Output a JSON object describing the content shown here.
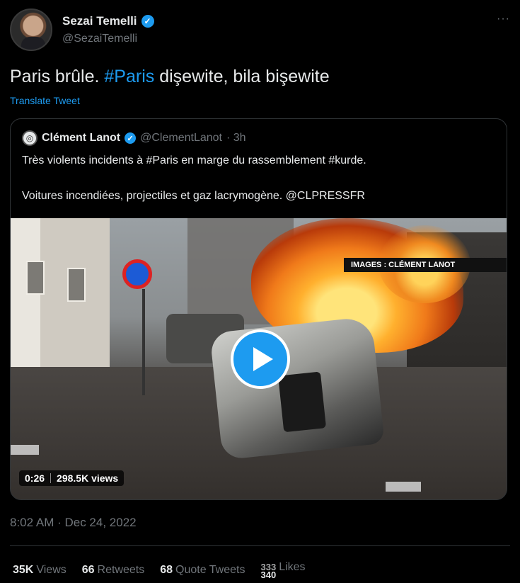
{
  "author": {
    "display_name": "Sezai Temelli",
    "handle": "@SezaiTemelli",
    "avatar_icon": "user-avatar",
    "verified_icon": "verified-badge-icon",
    "more_label": "···"
  },
  "tweet": {
    "text_before": "Paris brûle. ",
    "hashtag": "#Paris",
    "text_after": " dişewite, bila bişewite",
    "translate_label": "Translate Tweet",
    "timestamp": "8:02 AM · Dec 24, 2022"
  },
  "quoted": {
    "display_name": "Clément Lanot",
    "handle": "@ClementLanot",
    "time": "· 3h",
    "line1": "Très violents incidents à #Paris en marge du rassemblement #kurde.",
    "line2": "Voitures incendiées, projectiles et gaz lacrymogène. @CLPRESSFR",
    "media": {
      "watermark": "IMAGES : CLÉMENT LANOT",
      "duration": "0:26",
      "views": "298.5K views",
      "play_icon": "play-icon"
    }
  },
  "stats": {
    "views_num": "35K",
    "views_label": "Views",
    "retweets_num": "66",
    "retweets_label": "Retweets",
    "quotes_num": "68",
    "quotes_label": "Quote Tweets",
    "likes_num_top": "333",
    "likes_num": "340",
    "likes_label": "Likes"
  },
  "colors": {
    "background": "#000000",
    "accent": "#1d9bf0",
    "muted": "#71767b",
    "text": "#e7e9ea"
  }
}
